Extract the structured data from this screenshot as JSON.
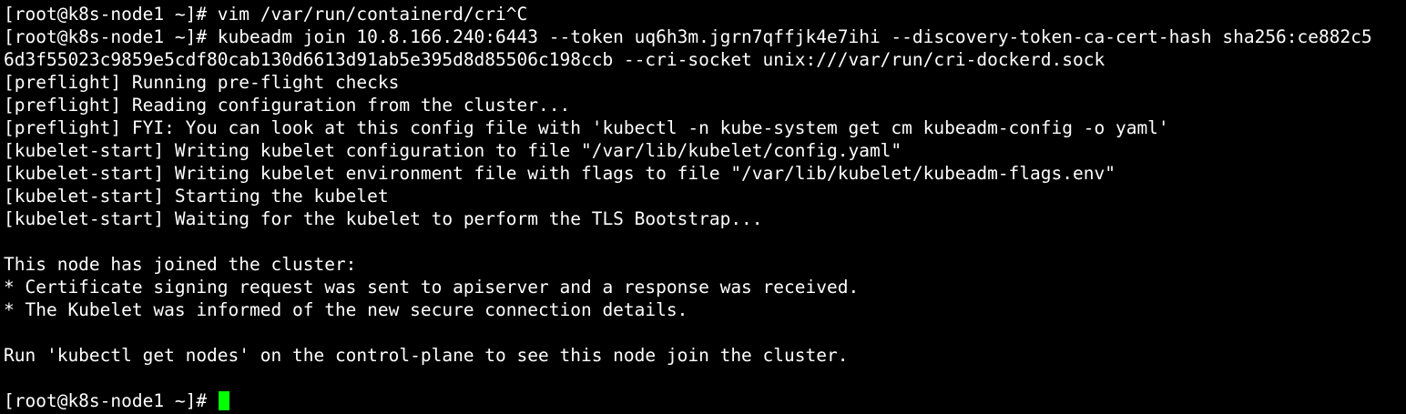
{
  "colors": {
    "background": "#000000",
    "foreground": "#ffffff",
    "cursor": "#00ff00"
  },
  "terminal": {
    "lines": [
      "[root@k8s-node1 ~]# vim /var/run/containerd/cri^C",
      "[root@k8s-node1 ~]# kubeadm join 10.8.166.240:6443 --token uq6h3m.jgrn7qffjk4e7ihi --discovery-token-ca-cert-hash sha256:ce882c5",
      "6d3f55023c9859e5cdf80cab130d6613d91ab5e395d8d85506c198ccb --cri-socket unix:///var/run/cri-dockerd.sock",
      "[preflight] Running pre-flight checks",
      "[preflight] Reading configuration from the cluster...",
      "[preflight] FYI: You can look at this config file with 'kubectl -n kube-system get cm kubeadm-config -o yaml'",
      "[kubelet-start] Writing kubelet configuration to file \"/var/lib/kubelet/config.yaml\"",
      "[kubelet-start] Writing kubelet environment file with flags to file \"/var/lib/kubelet/kubeadm-flags.env\"",
      "[kubelet-start] Starting the kubelet",
      "[kubelet-start] Waiting for the kubelet to perform the TLS Bootstrap...",
      "",
      "This node has joined the cluster:",
      "* Certificate signing request was sent to apiserver and a response was received.",
      "* The Kubelet was informed of the new secure connection details.",
      "",
      "Run 'kubectl get nodes' on the control-plane to see this node join the cluster.",
      ""
    ],
    "prompt": "[root@k8s-node1 ~]# "
  }
}
